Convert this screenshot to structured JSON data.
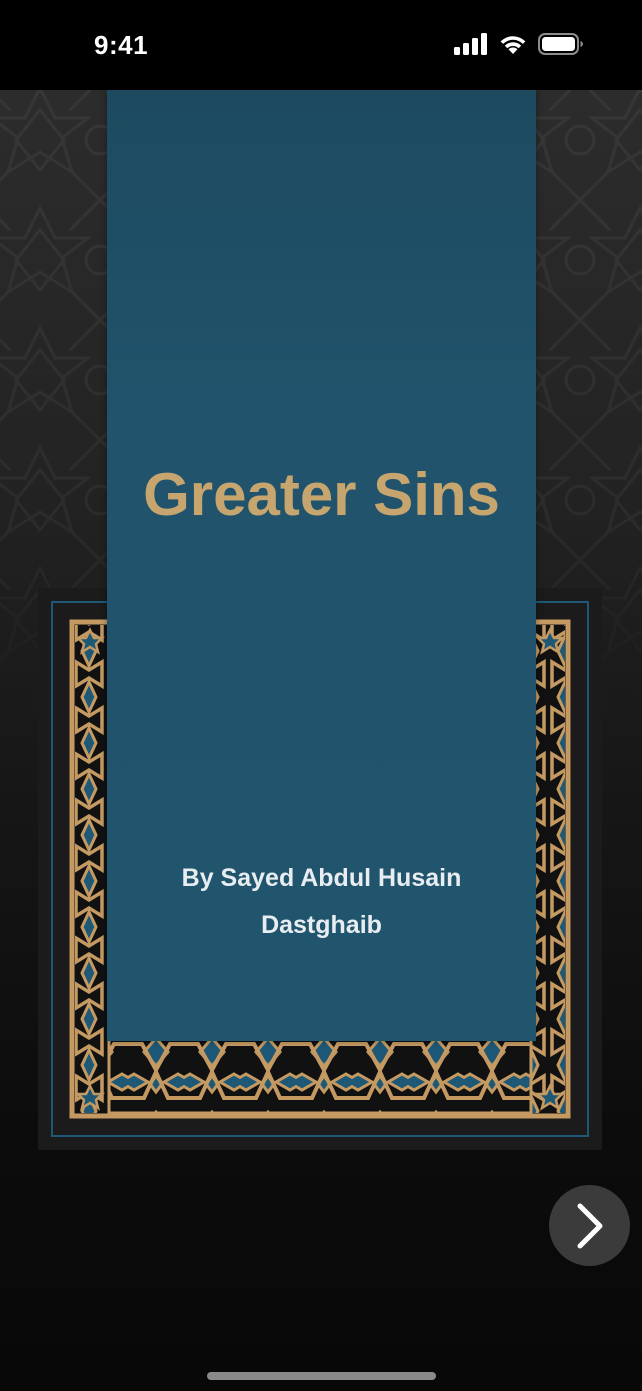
{
  "status_bar": {
    "time": "9:41",
    "signal_icon": "cellular-signal-icon",
    "wifi_icon": "wifi-icon",
    "battery_icon": "battery-icon"
  },
  "book": {
    "title": "Greater Sins",
    "author": "By Sayed Abdul Husain Dastghaib"
  },
  "navigation": {
    "next_icon": "chevron-right-icon"
  },
  "colors": {
    "cover": "#21546d",
    "title": "#c6a56f",
    "author": "#e8edf1",
    "ornament_gold": "#c49a62",
    "ornament_blue": "#1e5877",
    "background": "#0c0c0c"
  }
}
